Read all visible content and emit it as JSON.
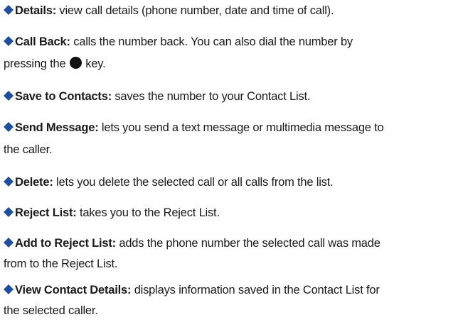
{
  "bullet_color": "#1d4f9c",
  "items": [
    {
      "term": "Details:",
      "lines": [
        "view call details (phone number, date and time of call)."
      ]
    },
    {
      "term": "Call Back:",
      "lines": [
        "calls the number back. You can also dial the number by",
        "pressing the",
        "key."
      ],
      "inline_icon": "send-key-icon"
    },
    {
      "term": "Save to Contacts:",
      "lines": [
        "saves the number to your Contact List."
      ]
    },
    {
      "term": "Send Message:",
      "lines": [
        "lets you send a text message or multimedia message to",
        "the caller."
      ]
    },
    {
      "term": "Delete:",
      "lines": [
        "lets you delete the selected call or all calls from the list."
      ]
    },
    {
      "term": "Reject List:",
      "lines": [
        "takes you to the Reject List."
      ]
    },
    {
      "term": "Add to Reject List:",
      "lines": [
        "adds the phone number the selected call was made",
        "from to the Reject List."
      ]
    },
    {
      "term": "View Contact Details:",
      "lines": [
        "displays information saved in the Contact List for",
        "the selected caller."
      ]
    }
  ]
}
